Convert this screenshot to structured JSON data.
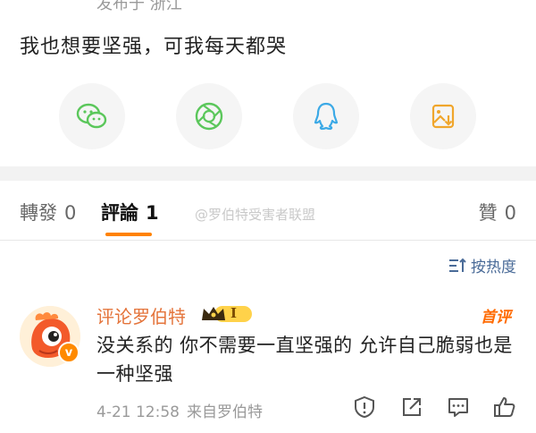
{
  "post": {
    "meta": "发布于 浙江",
    "text": "我也想要坚强，可我每天都哭"
  },
  "share": {
    "items": [
      {
        "icon": "wechat-icon",
        "color": "#5bc75b"
      },
      {
        "icon": "moments-icon",
        "color": "#5bc75b"
      },
      {
        "icon": "qq-icon",
        "color": "#3ba9e6"
      },
      {
        "icon": "save-image-icon",
        "color": "#f0a62c"
      }
    ]
  },
  "tabs": {
    "repost_label": "轉發",
    "repost_count": "0",
    "comment_label": "評論",
    "comment_count": "1",
    "like_label": "贊",
    "like_count": "0",
    "active_color": "#ff8200"
  },
  "watermark": "@罗伯特受害者联盟",
  "sort": {
    "label": "按热度"
  },
  "comment": {
    "username": "评论罗伯特",
    "level_badge": "I",
    "hot_tag": "首评",
    "text": "没关系的 你不需要一直坚强的 允许自己脆弱也是一种坚强",
    "time": "4-21 12:58",
    "source": "来自罗伯特",
    "verified_mark": "v",
    "username_color": "#e4743b"
  }
}
